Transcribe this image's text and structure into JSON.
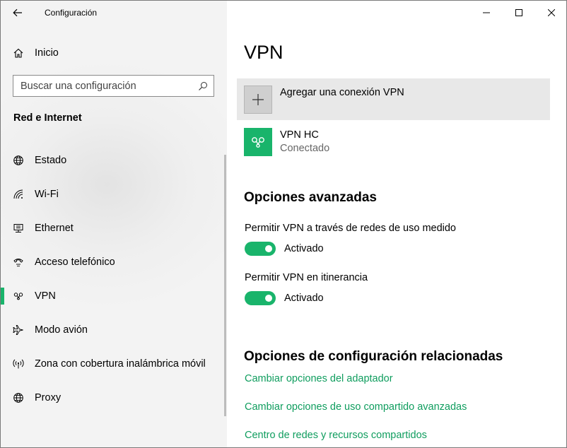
{
  "window": {
    "app_title": "Configuración",
    "controls": {
      "minimize": "minimize",
      "maximize": "maximize",
      "close": "close"
    }
  },
  "sidebar": {
    "home_label": "Inicio",
    "search_placeholder": "Buscar una configuración",
    "section_title": "Red e Internet",
    "items": [
      {
        "label": "Estado",
        "icon": "globe-icon"
      },
      {
        "label": "Wi-Fi",
        "icon": "wifi-icon"
      },
      {
        "label": "Ethernet",
        "icon": "ethernet-icon"
      },
      {
        "label": "Acceso telefónico",
        "icon": "dialup-icon"
      },
      {
        "label": "VPN",
        "icon": "vpn-icon",
        "active": true
      },
      {
        "label": "Modo avión",
        "icon": "airplane-icon"
      },
      {
        "label": "Zona con cobertura inalámbrica móvil",
        "icon": "hotspot-icon"
      },
      {
        "label": "Proxy",
        "icon": "globe-icon"
      }
    ]
  },
  "main": {
    "title": "VPN",
    "add_connection_label": "Agregar una conexión VPN",
    "connection": {
      "name": "VPN HC",
      "status": "Conectado"
    },
    "advanced": {
      "heading": "Opciones avanzadas",
      "options": [
        {
          "label": "Permitir VPN a través de redes de uso medido",
          "state": "Activado",
          "on": true
        },
        {
          "label": "Permitir VPN en itinerancia",
          "state": "Activado",
          "on": true
        }
      ]
    },
    "related": {
      "heading": "Opciones de configuración relacionadas",
      "links": [
        "Cambiar opciones del adaptador",
        "Cambiar opciones de uso compartido avanzadas",
        "Centro de redes y recursos compartidos"
      ]
    }
  },
  "colors": {
    "accent": "#19b46b",
    "link": "#0f9d5e",
    "sidebar_bg": "#f2f2f2",
    "add_row_bg": "#e8e8e8"
  }
}
